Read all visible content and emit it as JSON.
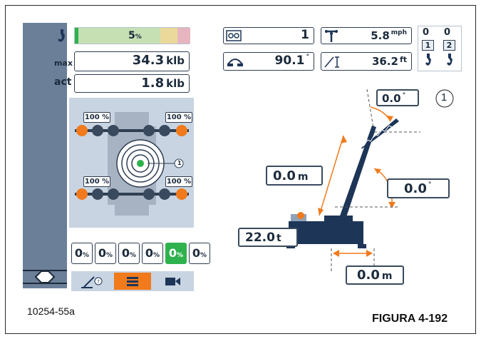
{
  "load": {
    "percent": "5",
    "percent_unit": "%",
    "max_label": "max",
    "max_value": "34.3",
    "max_unit": "klb",
    "act_label": "act",
    "act_value": "1.8",
    "act_unit": "klb"
  },
  "outriggers": {
    "front_left": "100 %",
    "front_right": "100 %",
    "rear_left": "100 %",
    "rear_right": "100 %",
    "callout": "1"
  },
  "counterweights": [
    {
      "value": "0",
      "unit": "%",
      "active": false
    },
    {
      "value": "0",
      "unit": "%",
      "active": false
    },
    {
      "value": "0",
      "unit": "%",
      "active": false
    },
    {
      "value": "0",
      "unit": "%",
      "active": false
    },
    {
      "value": "0",
      "unit": "%",
      "active": true
    },
    {
      "value": "0",
      "unit": "%",
      "active": false
    }
  ],
  "tabs": [
    {
      "icon": "boom-help-icon",
      "active": false
    },
    {
      "icon": "list-icon",
      "active": true
    },
    {
      "icon": "camera-icon",
      "active": false
    }
  ],
  "top_readouts": {
    "reeving_value": "1",
    "slew_angle": "90.1",
    "slew_unit": "°",
    "wind_speed": "5.8",
    "wind_unit": "mph",
    "tip_height": "36.2",
    "tip_unit": "ft",
    "hoist_1_count": "0",
    "hoist_2_count": "0",
    "hoist_1_number": "1",
    "hoist_2_number": "2"
  },
  "crane_diagram": {
    "jib_angle": "0.0",
    "jib_angle_unit": "°",
    "callout": "1",
    "boom_length": "0.0",
    "boom_length_unit": "m",
    "boom_angle": "0.0",
    "boom_angle_unit": "°",
    "counterweight": "22.0",
    "counterweight_unit": "t",
    "radius": "0.0",
    "radius_unit": "m"
  },
  "captions": {
    "code": "10254-55a",
    "figure": "FIGURA 4-192"
  },
  "colors": {
    "sidebar": "#6b7f99",
    "panel": "#c8d4e2",
    "accent_orange": "#f07a1c",
    "active_green": "#2eb24d",
    "crane_navy": "#1d3557"
  }
}
